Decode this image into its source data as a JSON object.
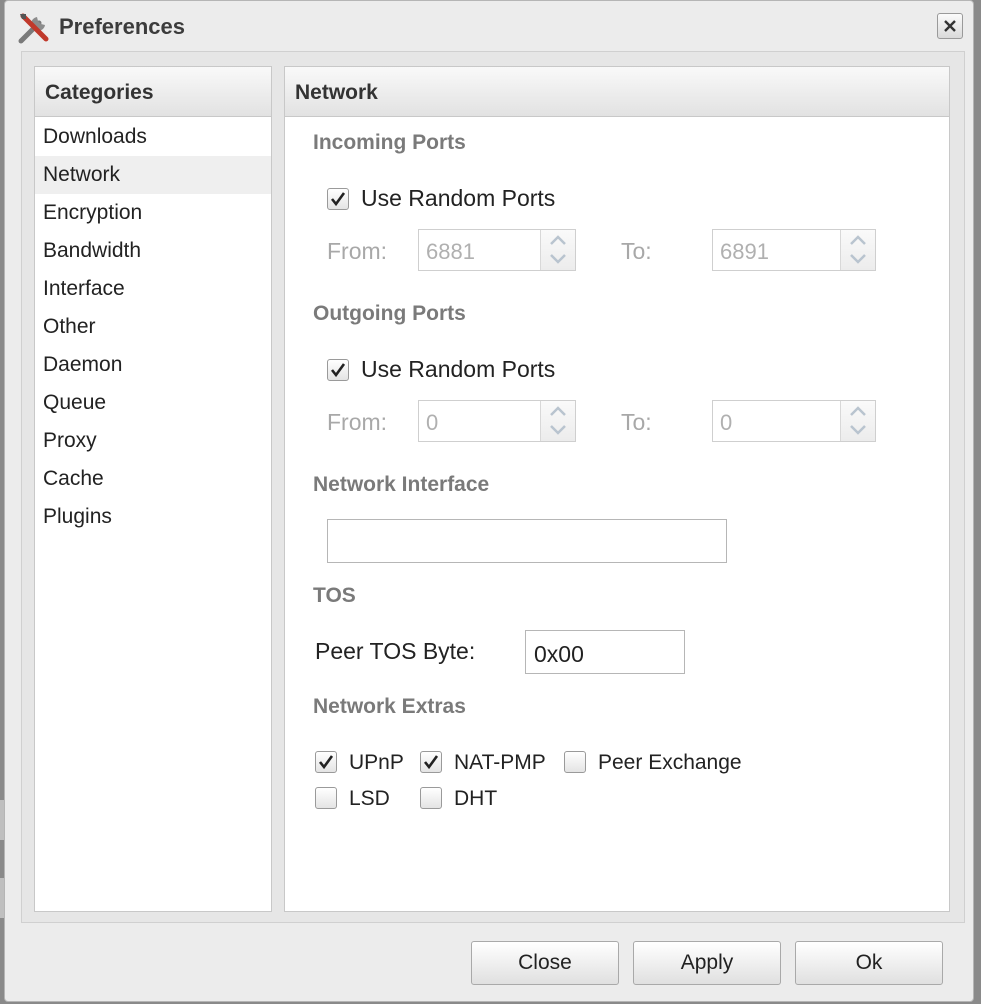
{
  "window": {
    "title": "Preferences"
  },
  "sidebar": {
    "header": "Categories",
    "items": [
      {
        "label": "Downloads"
      },
      {
        "label": "Network",
        "selected": true
      },
      {
        "label": "Encryption"
      },
      {
        "label": "Bandwidth"
      },
      {
        "label": "Interface"
      },
      {
        "label": "Other"
      },
      {
        "label": "Daemon"
      },
      {
        "label": "Queue"
      },
      {
        "label": "Proxy"
      },
      {
        "label": "Cache"
      },
      {
        "label": "Plugins"
      }
    ]
  },
  "network": {
    "header": "Network",
    "incoming": {
      "title": "Incoming Ports",
      "random_label": "Use Random Ports",
      "random_checked": true,
      "from_label": "From:",
      "from_value": "6881",
      "to_label": "To:",
      "to_value": "6891"
    },
    "outgoing": {
      "title": "Outgoing Ports",
      "random_label": "Use Random Ports",
      "random_checked": true,
      "from_label": "From:",
      "from_value": "0",
      "to_label": "To:",
      "to_value": "0"
    },
    "interface": {
      "title": "Network Interface",
      "value": ""
    },
    "tos": {
      "title": "TOS",
      "label": "Peer TOS Byte:",
      "value": "0x00"
    },
    "extras": {
      "title": "Network Extras",
      "upnp": {
        "label": "UPnP",
        "checked": true
      },
      "natpmp": {
        "label": "NAT-PMP",
        "checked": true
      },
      "pex": {
        "label": "Peer Exchange",
        "checked": false
      },
      "lsd": {
        "label": "LSD",
        "checked": false
      },
      "dht": {
        "label": "DHT",
        "checked": false
      }
    }
  },
  "buttons": {
    "close": "Close",
    "apply": "Apply",
    "ok": "Ok"
  }
}
